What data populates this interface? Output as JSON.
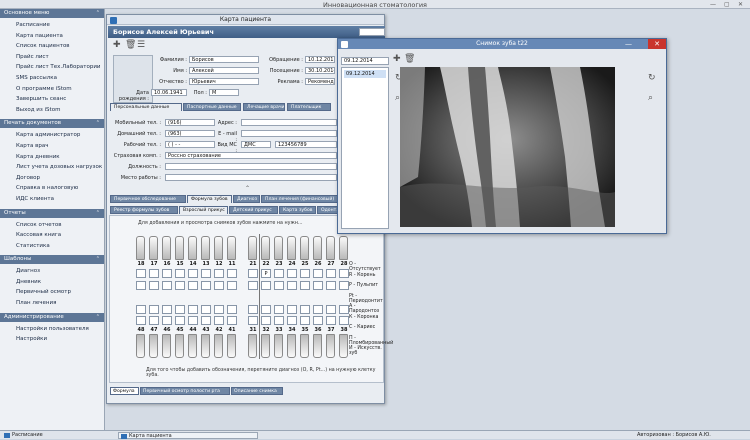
{
  "app_title": "Инновационная стоматология",
  "sidebar": [
    {
      "title": "Основное меню",
      "items": [
        "Расписание",
        "Карта пациента",
        "Список пациентов",
        "Прайс лист",
        "Прайс лист Тех.Лаборатории",
        "SMS рассылка",
        "О программе iStom",
        "Завершить сеанс",
        "Выход из iStom"
      ]
    },
    {
      "title": "Печать документов",
      "items": [
        "Карта администратор",
        "Карта врач",
        "Карта дневник",
        "Лист учета дозовых нагрузок",
        "Договор",
        "Справка в налоговую",
        "ИДС клиента"
      ]
    },
    {
      "title": "Отчеты",
      "items": [
        "Список отчетов",
        "Кассовая книга",
        "Статистика"
      ]
    },
    {
      "title": "Шаблоны",
      "items": [
        "Диагноз",
        "Дневник",
        "Первичный осмотр",
        "План лечения"
      ]
    },
    {
      "title": "Администрирование",
      "items": [
        "Настройки пользователя",
        "Настройки"
      ]
    }
  ],
  "patient_window": {
    "title": "Карта пациента",
    "patient_name": "Борисов Алексей Юрьевич",
    "labels": {
      "surname": "Фамилия :",
      "name": "Имя :",
      "patronymic": "Отчество :",
      "birth": "Дата рождения :",
      "sex": "Пол :",
      "appeal": "Обращение :",
      "visit": "Посещение :",
      "ads": "Реклама :",
      "mobile": "Мобильный тел. :",
      "home": "Домашний тел. :",
      "work": "Рабочий тел. :",
      "address": "Адрес :",
      "email": "E - mail :",
      "vid_ms": "Вид МС :",
      "insurance": "Страховая комп. :",
      "position": "Должность :",
      "workplace": "Место работы :"
    },
    "values": {
      "surname": "Борисов",
      "name": "Алексей",
      "patronymic": "Юрьевич",
      "birth": "10.06.1941",
      "sex": "М",
      "appeal": "10.12.2013",
      "visit": "30.10.2014",
      "ads": "Рекомендация",
      "mobile": "(916)",
      "home": "(963)",
      "work": "(   )    -   -",
      "vid_ms": "ДМС",
      "ms_number": "123456789",
      "insurance": "Россно страхование"
    },
    "top_tabs": [
      "Персональные данные",
      "Паспортные данные",
      "Лечащие врачи",
      "Плательщик"
    ],
    "mid_tabs": [
      "Первичное обследование",
      "Формула зубов",
      "Диагноз",
      "План лечения (финансовый)"
    ],
    "sub_tabs": [
      "Реестр формулы зубов",
      "Взрослый прикус",
      "Детский прикус",
      "Карта зубов",
      "Одонт..."
    ],
    "formula_hint": "Для добавления и просмотра снимков зубов нажмите на нужн...",
    "upper_teeth": [
      "18",
      "17",
      "16",
      "15",
      "14",
      "13",
      "12",
      "11",
      "21",
      "22",
      "23",
      "24",
      "25",
      "26",
      "27",
      "28"
    ],
    "lower_teeth": [
      "48",
      "47",
      "46",
      "45",
      "44",
      "43",
      "42",
      "41",
      "31",
      "32",
      "33",
      "34",
      "35",
      "36",
      "37",
      "38"
    ],
    "upper_marks": [
      "",
      "",
      "",
      "",
      "",
      "",
      "",
      "",
      "",
      "P",
      "",
      "",
      "",
      "",
      "",
      ""
    ],
    "legend": [
      "О - Отсутствует",
      "R - Корень",
      "P - Пульпит",
      "Pt - Периодонтит",
      "A - Пародонтоз",
      "К - Коронка",
      "С - Кариес",
      "П - Пломбированный",
      "И - Искусств. зуб"
    ],
    "footer_hint": "Для того чтобы добавить обозначения, перетяните диагноз (О, R, Pt...) на нужную клетку зуба.",
    "bottom_tabs": [
      "Формула",
      "Первичный осмотр полости рта",
      "Описание снимка"
    ]
  },
  "xray_window": {
    "title": "Снимок зуба t22",
    "selected_date": "09.12.2014",
    "tree_item": "09.12.2014"
  },
  "taskbar": {
    "items": [
      "Расписание",
      "Карта пациента"
    ],
    "status": "Авторизован : Борисов А.Ю."
  }
}
